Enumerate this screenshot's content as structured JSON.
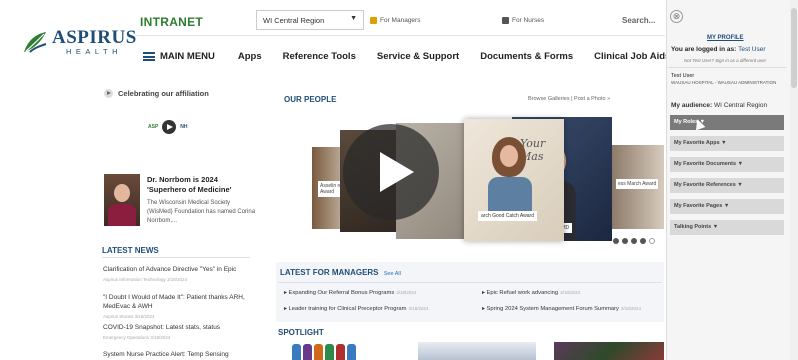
{
  "brand": {
    "name": "ASPIRUS",
    "sub": "HEALTH",
    "accent": "#1f4e79",
    "green": "#2e7d32"
  },
  "topbar": {
    "intranet": "INTRANET",
    "region": "WI Central Region",
    "for_managers": "For Managers",
    "for_nurses": "For Nurses",
    "search": "Search..."
  },
  "nav": {
    "menu": "MAIN MENU",
    "items": [
      "Apps",
      "Reference Tools",
      "Service & Support",
      "Documents & Forms",
      "Clinical Job Aids"
    ]
  },
  "left": {
    "affiliation": "Celebrating our affiliation",
    "feature_title": "Dr. Norrbom is 2024 'Superhero of Medicine'",
    "feature_desc": "The Wisconsin Medical Society (WisMed) Foundation has named Corina Norrbom,...",
    "latest_news": "LATEST NEWS",
    "news": [
      {
        "title": "Clarification of Advance Directive \"Yes\" in Epic",
        "meta": "Aspirus Information Technology 3/18/2024"
      },
      {
        "title": "\"I Doubt I Would of Made It\": Patient thanks ARH, MedEvac & AWH",
        "meta": "Aspirus Stories 3/18/2024"
      },
      {
        "title": "COVID-19 Snapshot: Latest stats, status",
        "meta": "Emergency Operations 3/18/2024"
      },
      {
        "title": "System Nurse Practice Alert: Temp Sensing",
        "meta": ""
      }
    ]
  },
  "center": {
    "our_people": "OUR PEOPLE",
    "browse": "Browse Galleries | Post a Photo »",
    "captions": {
      "left": "Asselin re Award",
      "main": "arch Good Catch Award",
      "right_man": "engrud, MD",
      "far_right": "ess March Award",
      "script": "Your Mas"
    },
    "latest_managers": "LATEST FOR MANAGERS",
    "see_all": "See All",
    "manager_items": [
      {
        "title": "Expanding Our Referral Bonus Programs",
        "date": "3/18/2024"
      },
      {
        "title": "Epic Refuel work advancing",
        "date": "3/18/2024"
      },
      {
        "title": "Leader training for Clinical Preceptor Program",
        "date": "3/18/2024"
      },
      {
        "title": "Spring 2024 System Management Forum Summary",
        "date": "3/18/2024"
      }
    ],
    "spotlight": "SPOTLIGHT",
    "carousel_active": 4,
    "carousel_total": 5
  },
  "panel": {
    "close": "⊗",
    "my_profile": "MY PROFILE",
    "logged_in_label": "You are logged in as:",
    "user": "Test User",
    "not_user": "Not Test User? Sign in as a different user",
    "test_user": "Test User",
    "hospital": "WAUSAU HOSPITAL - WAUSAU ADMINISTRATION",
    "audience_label": "My audience:",
    "audience": "WI Central Region",
    "buttons": [
      "My Roles ▼",
      "My Favorite Apps ▼",
      "My Favorite Documents ▼",
      "My Favorite References ▼",
      "My Favorite Pages ▼",
      "Talking Points ▼"
    ]
  }
}
